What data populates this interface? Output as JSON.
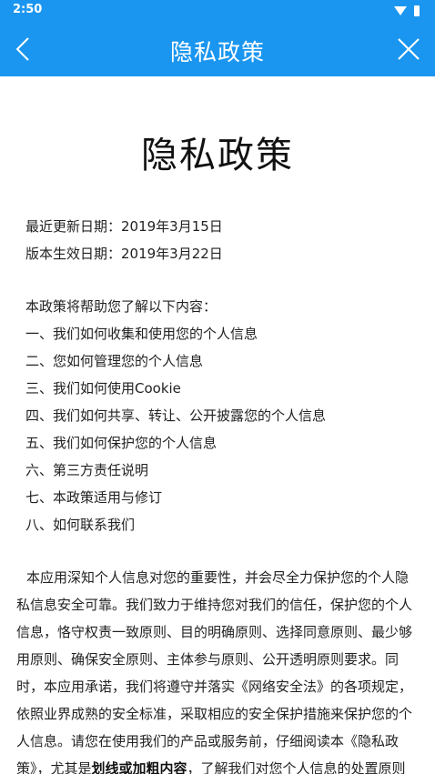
{
  "status_bar": {
    "time": "2:50"
  },
  "app_bar": {
    "title": "隐私政策"
  },
  "document": {
    "title": "隐私政策",
    "updated_date": "最近更新日期：2019年3月15日",
    "effective_date": "版本生效日期：2019年3月22日",
    "toc_intro": "本政策将帮助您了解以下内容：",
    "toc": [
      "一、我们如何收集和使用您的个人信息",
      "二、您如何管理您的个人信息",
      "三、我们如何使用Cookie",
      "四、我们如何共享、转让、公开披露您的个人信息",
      "五、我们如何保护您的个人信息",
      "六、第三方责任说明",
      "七、本政策适用与修订",
      "八、如何联系我们"
    ],
    "para_part1": "本应用深知个人信息对您的重要性，并会尽全力保护您的个人隐私信息安全可靠。我们致力于维持您对我们的信任，保护您的个人信息，恪守权责一致原则、目的明确原则、选择同意原则、最少够用原则、确保安全原则、主体参与原则、公开透明原则要求。同时，本应用承诺，我们将遵守并落实《网络安全法》的各项规定，依照业界成熟的安全标准，采取相应的安全保护措施来保护您的个人信息。请您在使用我们的产品或服务前，仔细阅读本《隐私政策》，尤其是",
    "para_bold": "划线或加粗内容",
    "para_part2": "，了解我们对您个人信息的处置原则"
  },
  "colors": {
    "accent": "#1a96f0",
    "text": "#222222",
    "background": "#ffffff"
  }
}
